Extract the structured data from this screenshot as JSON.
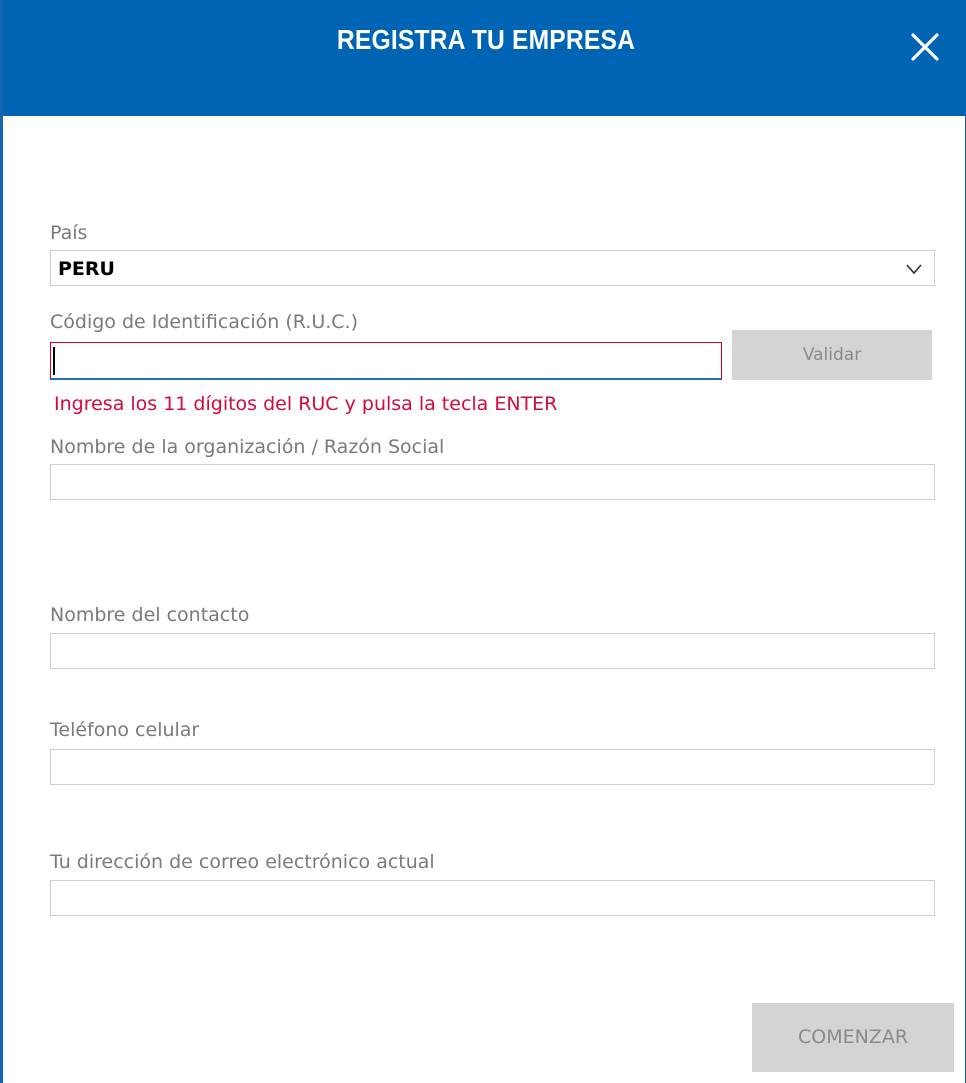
{
  "header": {
    "title": "REGISTRA TU EMPRESA",
    "close_icon": "close-icon",
    "background_color": "#0064b4"
  },
  "form": {
    "country": {
      "label": "País",
      "selected": "PERU"
    },
    "ruc": {
      "label": "Código de Identificación (R.U.C.)",
      "value": "",
      "validate_label": "Validar",
      "error": "Ingresa los 11 dígitos del RUC y pulsa la tecla ENTER"
    },
    "organization": {
      "label": "Nombre de la organización / Razón Social",
      "value": ""
    },
    "contact": {
      "label": "Nombre del contacto",
      "value": ""
    },
    "phone": {
      "label": "Teléfono celular",
      "value": ""
    },
    "email": {
      "label": "Tu dirección de correo electrónico actual",
      "value": ""
    },
    "submit_label": "COMENZAR"
  },
  "colors": {
    "error": "#d40a3c",
    "disabled_button": "#d4d4d4",
    "input_border": "#cfcfcf"
  }
}
